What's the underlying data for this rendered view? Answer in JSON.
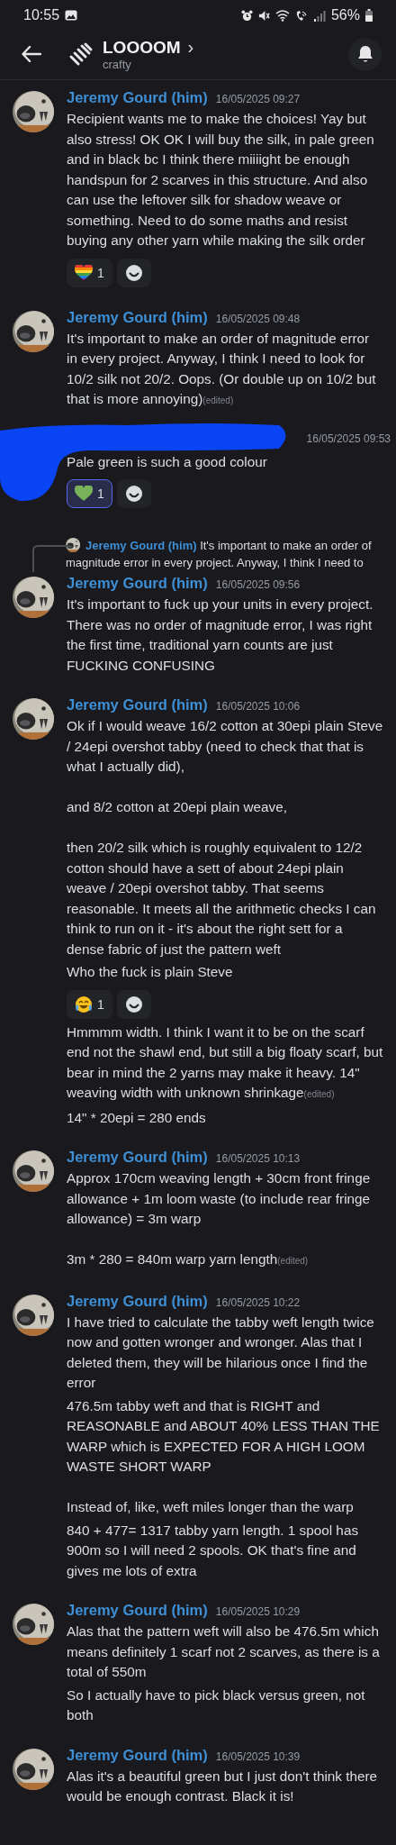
{
  "status_bar": {
    "time": "10:55",
    "battery": "56%"
  },
  "header": {
    "title": "LOOOOM",
    "chevron": "›",
    "subtitle": "crafty"
  },
  "groups": [
    {
      "author": "Jeremy Gourd (him)",
      "timestamp": "16/05/2025 09:27",
      "messages": [
        {
          "text": "Recipient wants me to make the choices! Yay but also stress! OK OK I will buy the silk, in pale green and in black bc I think there miiiight be enough handspun for 2 scarves in this structure. And also can use the leftover silk for shadow weave or something. Need to do some maths and resist buying any other yarn while making the silk order",
          "reactions": [
            {
              "kind": "rainbow-heart",
              "count": "1",
              "selected": false
            }
          ]
        }
      ]
    },
    {
      "author": "Jeremy Gourd (him)",
      "timestamp": "16/05/2025 09:48",
      "messages": [
        {
          "text": "It's important to make an order of magnitude error in every project. Anyway, I think I need to look for 10/2 silk not 20/2. Oops. (Or double up on 10/2 but that is more annoying)",
          "edited_label": "(edited)"
        }
      ]
    },
    {
      "redacted": true,
      "timestamp": "16/05/2025 09:53",
      "messages": [
        {
          "text": "Pale green is such a good colour",
          "reactions": [
            {
              "kind": "green-heart",
              "count": "1",
              "selected": true
            }
          ]
        }
      ]
    },
    {
      "reply": {
        "author": "Jeremy Gourd (him)",
        "text": "It's important to make an order of magnitude error in every project. Anyway, I think I need to"
      },
      "author": "Jeremy Gourd (him)",
      "timestamp": "16/05/2025 09:56",
      "messages": [
        {
          "text": "It's important to fuck up your units in every project. There was no order of magnitude error, I was right the first time, traditional yarn counts are just FUCKING CONFUSING"
        }
      ]
    },
    {
      "author": "Jeremy Gourd (him)",
      "timestamp": "16/05/2025 10:06",
      "messages": [
        {
          "text": "Ok if I would weave 16/2 cotton at 30epi plain Steve / 24epi overshot tabby (need to check that that is what I actually did),\n\nand 8/2 cotton at 20epi plain weave,\n\nthen 20/2 silk which is roughly equivalent to 12/2 cotton should have a sett of about 24epi plain weave / 20epi overshot tabby. That seems reasonable. It meets all the arithmetic checks I can think to run on it - it's about the right sett for a dense fabric of just the pattern weft"
        },
        {
          "text": "Who the fuck is plain Steve",
          "reactions": [
            {
              "kind": "laughing",
              "count": "1",
              "selected": false
            }
          ]
        },
        {
          "text": "Hmmmm width. I think I want it to be on the scarf end not the shawl end, but still a big floaty scarf, but bear in mind the 2 yarns may make it heavy. 14\" weaving width with unknown shrinkage",
          "edited_label": "(edited)"
        },
        {
          "text": "14\" * 20epi = 280 ends"
        }
      ]
    },
    {
      "author": "Jeremy Gourd (him)",
      "timestamp": "16/05/2025 10:13",
      "messages": [
        {
          "text": "Approx 170cm weaving length + 30cm front fringe allowance + 1m loom waste (to include rear fringe allowance) = 3m warp\n\n3m * 280 = 840m warp yarn length",
          "edited_label": "(edited)"
        }
      ]
    },
    {
      "author": "Jeremy Gourd (him)",
      "timestamp": "16/05/2025 10:22",
      "messages": [
        {
          "text": "I have tried to calculate the tabby weft length twice now and gotten wronger and wronger. Alas that I deleted them, they will be hilarious once I find the error"
        },
        {
          "text": "476.5m tabby weft and that is RIGHT and REASONABLE and ABOUT 40% LESS THAN THE WARP which is EXPECTED FOR A HIGH LOOM WASTE SHORT WARP\n\nInstead of, like, weft miles longer than the warp"
        },
        {
          "text": "840 + 477= 1317 tabby yarn length. 1 spool has 900m so I will need 2 spools. OK that's fine and gives me lots of extra"
        }
      ]
    },
    {
      "author": "Jeremy Gourd (him)",
      "timestamp": "16/05/2025 10:29",
      "messages": [
        {
          "text": "Alas that the pattern weft will also be 476.5m which means definitely 1 scarf not 2 scarves, as there is a total of 550m"
        },
        {
          "text": "So I actually have to pick black versus green, not both"
        }
      ]
    },
    {
      "author": "Jeremy Gourd (him)",
      "timestamp": "16/05/2025 10:39",
      "messages": [
        {
          "text": "Alas it's a beautiful green but I just don't think there would be enough contrast. Black it is!"
        }
      ]
    }
  ]
}
